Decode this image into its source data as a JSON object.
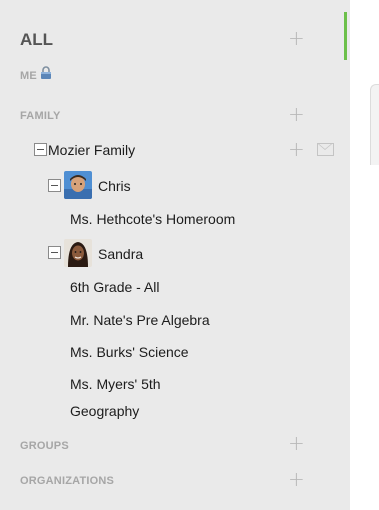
{
  "sidebar": {
    "all_label": "ALL",
    "me_label": "ME",
    "family_label": "FAMILY",
    "family_group": "Mozier Family",
    "children": [
      {
        "name": "Chris",
        "classes": [
          "Ms. Hethcote's Homeroom"
        ]
      },
      {
        "name": "Sandra",
        "classes": [
          "6th Grade - All",
          "Mr. Nate's Pre Algebra",
          "Ms. Burks' Science",
          "Ms. Myers' 5th",
          "Geography"
        ]
      }
    ],
    "groups_label": "GROUPS",
    "organizations_label": "ORGANIZATIONS",
    "plus_glyph": "+"
  },
  "colors": {
    "active_indicator": "#6cc04a",
    "panel_bg": "#eaeaea"
  },
  "icons": [
    "lock-icon",
    "plus-icon",
    "mail-icon",
    "collapse-icon",
    "avatar-chris",
    "avatar-sandra"
  ]
}
